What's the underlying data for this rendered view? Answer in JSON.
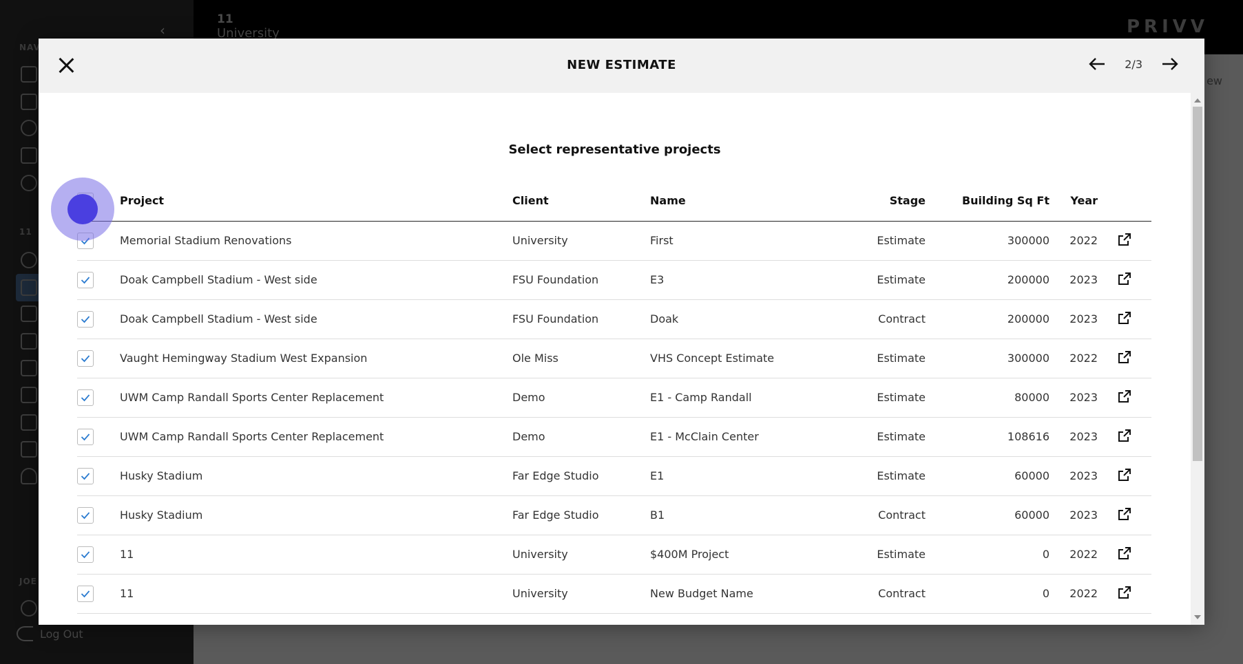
{
  "background": {
    "project_number": "11",
    "project_name": "University",
    "brand": "PRIVV",
    "section_nav_label": "NAV",
    "section_project_label": "11",
    "section_user_label": "JOE",
    "logout_label": "Log Out",
    "peek_text": "ew"
  },
  "modal": {
    "title": "NEW ESTIMATE",
    "page_indicator": "2/3",
    "section_title": "Select representative projects"
  },
  "table": {
    "headers": {
      "project": "Project",
      "client": "Client",
      "name": "Name",
      "stage": "Stage",
      "sqft": "Building Sq Ft",
      "year": "Year"
    },
    "rows": [
      {
        "project": "Memorial Stadium Renovations",
        "client": "University",
        "name": "First",
        "stage": "Estimate",
        "sqft": "300000",
        "year": "2022",
        "checked": true
      },
      {
        "project": "Doak Campbell Stadium - West side",
        "client": "FSU Foundation",
        "name": "E3",
        "stage": "Estimate",
        "sqft": "200000",
        "year": "2023",
        "checked": true
      },
      {
        "project": "Doak Campbell Stadium - West side",
        "client": "FSU Foundation",
        "name": "Doak",
        "stage": "Contract",
        "sqft": "200000",
        "year": "2023",
        "checked": true
      },
      {
        "project": "Vaught Hemingway Stadium West Expansion",
        "client": "Ole Miss",
        "name": "VHS Concept Estimate",
        "stage": "Estimate",
        "sqft": "300000",
        "year": "2022",
        "checked": true
      },
      {
        "project": "UWM Camp Randall Sports Center Replacement",
        "client": "Demo",
        "name": "E1 - Camp Randall",
        "stage": "Estimate",
        "sqft": "80000",
        "year": "2023",
        "checked": true
      },
      {
        "project": "UWM Camp Randall Sports Center Replacement",
        "client": "Demo",
        "name": "E1 - McClain Center",
        "stage": "Estimate",
        "sqft": "108616",
        "year": "2023",
        "checked": true
      },
      {
        "project": "Husky Stadium",
        "client": "Far Edge Studio",
        "name": "E1",
        "stage": "Estimate",
        "sqft": "60000",
        "year": "2023",
        "checked": true
      },
      {
        "project": "Husky Stadium",
        "client": "Far Edge Studio",
        "name": "B1",
        "stage": "Contract",
        "sqft": "60000",
        "year": "2023",
        "checked": true
      },
      {
        "project": "11",
        "client": "University",
        "name": "$400M Project",
        "stage": "Estimate",
        "sqft": "0",
        "year": "2022",
        "checked": true
      },
      {
        "project": "11",
        "client": "University",
        "name": "New Budget Name",
        "stage": "Contract",
        "sqft": "0",
        "year": "2022",
        "checked": true
      }
    ]
  },
  "colors": {
    "check": "#2a7bd0",
    "click_indicator": "#4a3fe0"
  }
}
